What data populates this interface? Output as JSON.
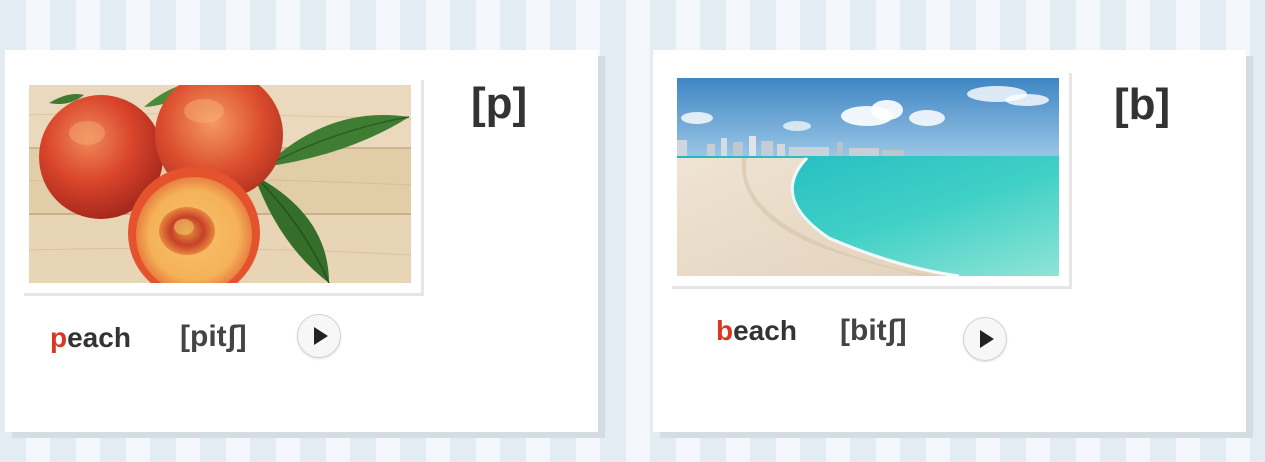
{
  "cards": [
    {
      "phoneme": "[p]",
      "word_first_letter": "p",
      "word_rest": "each",
      "ipa": "[pitʃ]",
      "image": "peach-photo",
      "play_icon": "play-icon"
    },
    {
      "phoneme": "[b]",
      "word_first_letter": "b",
      "word_rest": "each",
      "ipa": "[bitʃ]",
      "image": "beach-photo",
      "play_icon": "play-icon"
    }
  ],
  "colors": {
    "first_letter": "#d9371f",
    "text": "#333333",
    "background_stripe": "#e3ebf3"
  }
}
